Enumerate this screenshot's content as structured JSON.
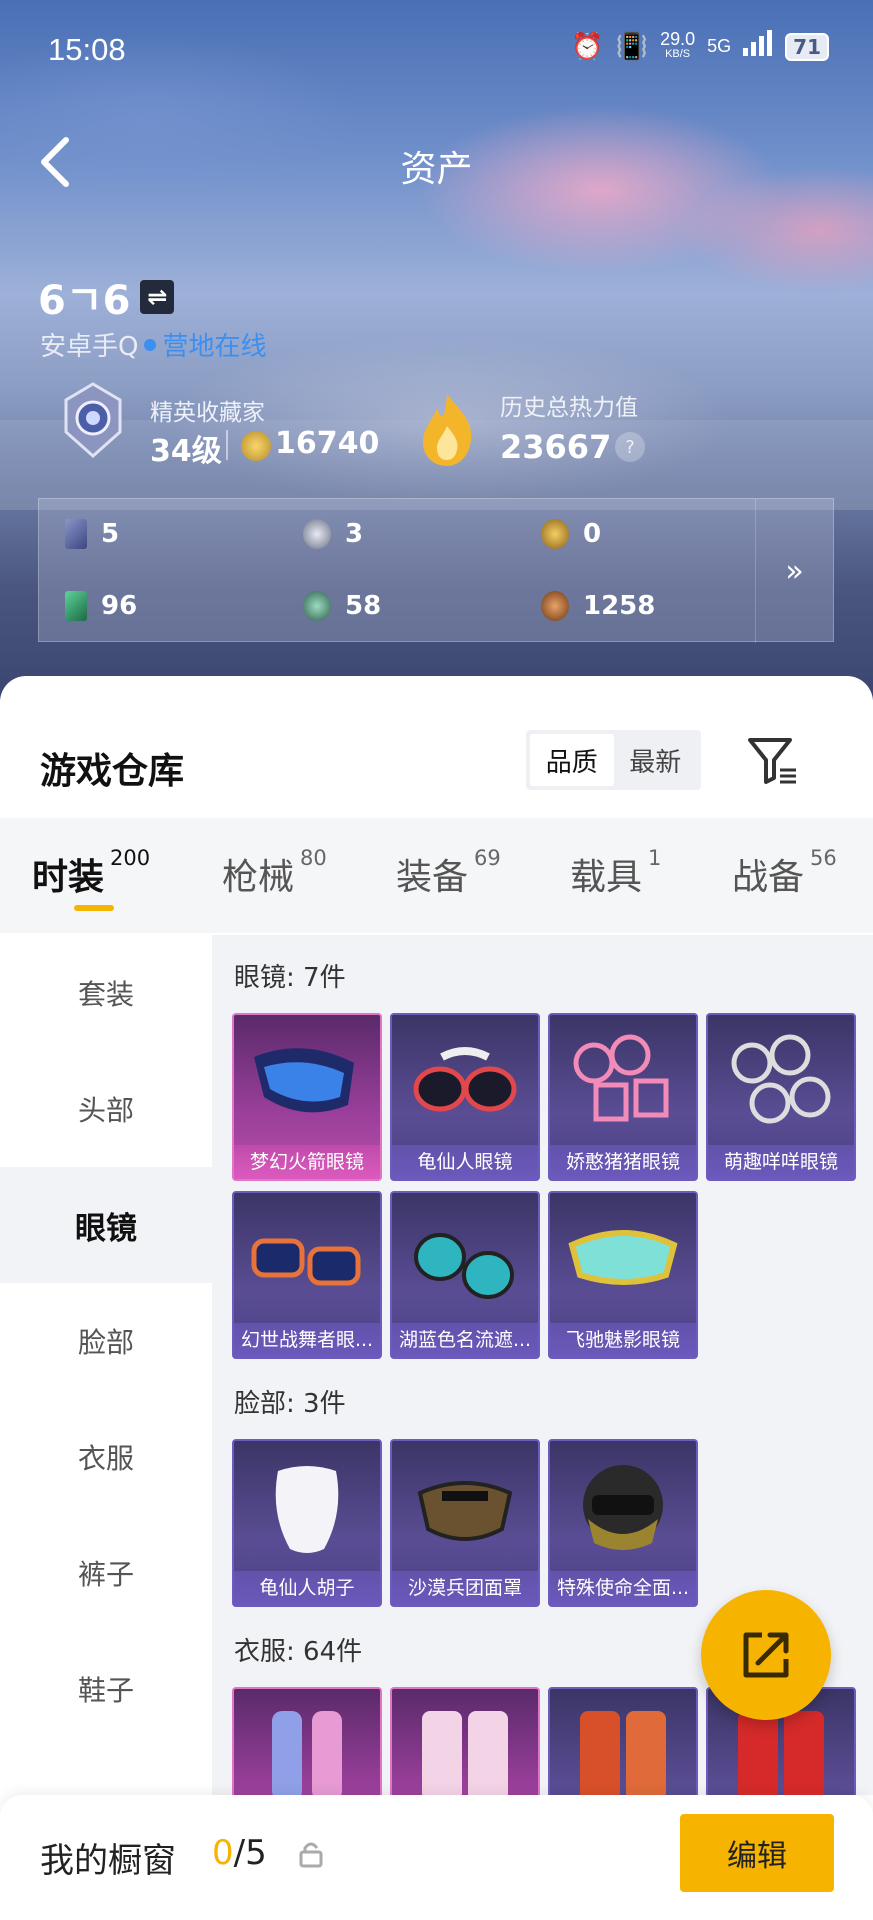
{
  "status_bar": {
    "time": "15:08",
    "speed_value": "29.0",
    "speed_unit": "KB/S",
    "network": "5G",
    "battery": "71"
  },
  "header": {
    "title": "资产"
  },
  "player": {
    "name": "6ㄱ6",
    "subtitle": "安卓手Q",
    "online_status": "营地在线"
  },
  "collector": {
    "title": "精英收藏家",
    "level": "34级",
    "points": "16740"
  },
  "heat": {
    "title": "历史总热力值",
    "value": "23667",
    "help": "?"
  },
  "currencies": [
    {
      "icon": "card-icon",
      "value": "5",
      "color": "#9aa6d8"
    },
    {
      "icon": "silver-coin-icon",
      "value": "3",
      "color": "#c7ccd9"
    },
    {
      "icon": "gold-coin-icon",
      "value": "0",
      "color": "#d8a93a"
    },
    {
      "icon": "green-ticket-icon",
      "value": "96",
      "color": "#3fb07a"
    },
    {
      "icon": "emerald-coin-icon",
      "value": "58",
      "color": "#5aa888"
    },
    {
      "icon": "bronze-coin-icon",
      "value": "1258",
      "color": "#c2763a"
    }
  ],
  "currency_more": "»",
  "warehouse": {
    "title": "游戏仓库",
    "sort_options": [
      "品质",
      "最新"
    ],
    "sort_active": "品质"
  },
  "categories": [
    {
      "label": "时装",
      "count": "200"
    },
    {
      "label": "枪械",
      "count": "80"
    },
    {
      "label": "装备",
      "count": "69"
    },
    {
      "label": "载具",
      "count": "1"
    },
    {
      "label": "战备",
      "count": "56"
    }
  ],
  "subcategories": [
    "套装",
    "头部",
    "眼镜",
    "脸部",
    "衣服",
    "裤子",
    "鞋子"
  ],
  "subcategory_active": "眼镜",
  "sections": [
    {
      "title": "眼镜: 7件",
      "items": [
        "梦幻火箭眼镜",
        "龟仙人眼镜",
        "娇憨猪猪眼镜",
        "萌趣咩咩眼镜",
        "幻世战舞者眼...",
        "湖蓝色名流遮...",
        "飞驰魅影眼镜"
      ]
    },
    {
      "title": "脸部: 3件",
      "items": [
        "龟仙人胡子",
        "沙漠兵团面罩",
        "特殊使命全面..."
      ]
    },
    {
      "title": "衣服: 64件",
      "items": [
        "",
        "",
        "",
        ""
      ]
    }
  ],
  "bottom_bar": {
    "label": "我的橱窗",
    "current": "0",
    "total": "/5",
    "edit": "编辑"
  },
  "colors": {
    "accent": "#f6b400",
    "online": "#3a8ff0",
    "item_purple": "#6e5bbf",
    "item_pink": "#e274c8"
  }
}
